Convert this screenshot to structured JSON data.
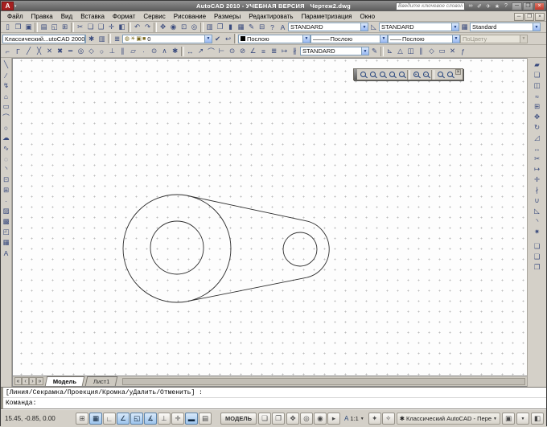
{
  "window": {
    "logo_letter": "A",
    "title_app": "AutoCAD 2010 - УЧЕБНАЯ ВЕРСИЯ",
    "title_doc": "Чертеж2.dwg",
    "infocenter": {
      "placeholder": "Введите ключевое слово/фразу",
      "icons": [
        {
          "name": "search-binoculars-icon",
          "glyph": "∞"
        },
        {
          "name": "tools-icon",
          "glyph": "✐"
        },
        {
          "name": "communication-center-icon",
          "glyph": "✈"
        },
        {
          "name": "favorites-star-icon",
          "glyph": "★"
        },
        {
          "name": "help-icon",
          "glyph": "?"
        }
      ]
    },
    "controls": {
      "minimize": "─",
      "restore": "❐",
      "close": "×"
    },
    "doc_controls": {
      "minimize": "─",
      "restore": "❐",
      "close": "×"
    }
  },
  "menu": {
    "items": [
      {
        "name": "menu-file",
        "label": "Файл"
      },
      {
        "name": "menu-edit",
        "label": "Правка"
      },
      {
        "name": "menu-view",
        "label": "Вид"
      },
      {
        "name": "menu-insert",
        "label": "Вставка"
      },
      {
        "name": "menu-format",
        "label": "Формат"
      },
      {
        "name": "menu-tools",
        "label": "Сервис"
      },
      {
        "name": "menu-draw",
        "label": "Рисование"
      },
      {
        "name": "menu-dimension",
        "label": "Размеры"
      },
      {
        "name": "menu-modify",
        "label": "Редактировать"
      },
      {
        "name": "menu-parametric",
        "label": "Параметризация"
      },
      {
        "name": "menu-window",
        "label": "Окно"
      }
    ]
  },
  "toolbars": {
    "standard": {
      "icons": [
        {
          "name": "qnew-icon",
          "glyph": "▯"
        },
        {
          "name": "open-icon",
          "glyph": "❒"
        },
        {
          "name": "save-icon",
          "glyph": "▣"
        },
        {
          "divider": true
        },
        {
          "name": "plot-icon",
          "glyph": "▤"
        },
        {
          "name": "plot-preview-icon",
          "glyph": "◱"
        },
        {
          "name": "publish-icon",
          "glyph": "⊞"
        },
        {
          "divider": true
        },
        {
          "name": "cut-icon",
          "glyph": "✂"
        },
        {
          "name": "copy-clip-icon",
          "glyph": "❏"
        },
        {
          "name": "paste-icon",
          "glyph": "❑"
        },
        {
          "name": "match-properties-icon",
          "glyph": "✛"
        },
        {
          "name": "block-editor-icon",
          "glyph": "◧"
        },
        {
          "divider": true
        },
        {
          "name": "undo-icon",
          "glyph": "↶"
        },
        {
          "name": "redo-icon",
          "glyph": "↷"
        },
        {
          "divider": true
        },
        {
          "name": "pan-realtime-icon",
          "glyph": "✥"
        },
        {
          "name": "zoom-realtime-icon",
          "glyph": "◉"
        },
        {
          "name": "zoom-window-icon",
          "glyph": "⊡"
        },
        {
          "name": "zoom-previous-icon",
          "glyph": "◎"
        },
        {
          "divider": true
        },
        {
          "name": "properties-palette-icon",
          "glyph": "▥"
        },
        {
          "name": "designcenter-icon",
          "glyph": "❐"
        },
        {
          "name": "tool-palettes-icon",
          "glyph": "▮"
        },
        {
          "name": "sheet-set-manager-icon",
          "glyph": "▦"
        },
        {
          "name": "markup-icon",
          "glyph": "✎"
        },
        {
          "name": "quickcalc-icon",
          "glyph": "⊟"
        },
        {
          "name": "help-question-icon",
          "glyph": "?"
        }
      ]
    },
    "styles": {
      "text_style_icon": "A",
      "text_style": "STANDARD",
      "dim_style_icon": "◺",
      "dim_style": "STANDARD",
      "table_style_icon": "▦",
      "table_style": "Standard"
    },
    "workspace": {
      "value": "Классический...utoCAD 2000",
      "icons": [
        {
          "name": "workspace-settings-icon",
          "glyph": "✱"
        },
        {
          "name": "workspace-save-icon",
          "glyph": "▥"
        }
      ]
    },
    "layers": {
      "manager_glyph": "≣",
      "combo_icons": [
        {
          "name": "layer-on-bulb-icon",
          "glyph": "◍"
        },
        {
          "name": "layer-freeze-sun-icon",
          "glyph": "☀"
        },
        {
          "name": "layer-lock-icon",
          "glyph": "▣"
        },
        {
          "name": "layer-color-swatch-icon",
          "glyph": "■"
        }
      ],
      "current": "0",
      "after_icons": [
        {
          "name": "make-object-layer-current-icon",
          "glyph": "✔"
        },
        {
          "name": "layer-previous-icon",
          "glyph": "↩"
        }
      ]
    },
    "properties": {
      "color": "Послою",
      "linetype_prefix": "———",
      "linetype": "Послою",
      "lineweight_prefix": "——",
      "lineweight": "Послою",
      "plotstyle": "ПоЦвету"
    },
    "osnap": {
      "icons": [
        {
          "name": "temporary-track-point-icon",
          "glyph": "⌐"
        },
        {
          "name": "snap-from-icon",
          "glyph": "Γ"
        },
        {
          "name": "snap-endpoint-icon",
          "glyph": "╱"
        },
        {
          "name": "snap-midpoint-icon",
          "glyph": "╳"
        },
        {
          "name": "snap-intersection-icon",
          "glyph": "✕"
        },
        {
          "name": "snap-apparent-intersection-icon",
          "glyph": "✖"
        },
        {
          "name": "snap-extension-icon",
          "glyph": "━"
        },
        {
          "name": "snap-center-icon",
          "glyph": "◎"
        },
        {
          "name": "snap-quadrant-icon",
          "glyph": "◇"
        },
        {
          "name": "snap-tangent-icon",
          "glyph": "○"
        },
        {
          "name": "snap-perpendicular-icon",
          "glyph": "⊥"
        },
        {
          "name": "snap-parallel-icon",
          "glyph": "∥"
        },
        {
          "name": "snap-insert-icon",
          "glyph": "▱"
        },
        {
          "name": "snap-node-icon",
          "glyph": "∙"
        },
        {
          "name": "snap-nearest-icon",
          "glyph": "⊙"
        },
        {
          "name": "snap-none-icon",
          "glyph": "∧"
        },
        {
          "name": "osnap-settings-icon",
          "glyph": "✱"
        }
      ]
    },
    "dimension": {
      "icons": [
        {
          "name": "dim-linear-icon",
          "glyph": "↔"
        },
        {
          "name": "dim-aligned-icon",
          "glyph": "↗"
        },
        {
          "name": "dim-arc-length-icon",
          "glyph": "⌒"
        },
        {
          "name": "dim-ordinate-icon",
          "glyph": "⊢"
        },
        {
          "name": "dim-radius-icon",
          "glyph": "⊙"
        },
        {
          "name": "dim-diameter-icon",
          "glyph": "⊘"
        },
        {
          "name": "dim-angular-icon",
          "glyph": "∠"
        },
        {
          "name": "dim-quick-icon",
          "glyph": "≡"
        },
        {
          "name": "dim-baseline-icon",
          "glyph": "≣"
        },
        {
          "name": "dim-continue-icon",
          "glyph": "↦"
        },
        {
          "name": "dim-break-icon",
          "glyph": "∦"
        }
      ],
      "style": "STANDARD",
      "after_icons": [
        {
          "name": "dimension-update-icon",
          "glyph": "✎"
        }
      ]
    },
    "parametric": {
      "icons": [
        {
          "name": "auto-constrain-icon",
          "glyph": "⊾"
        },
        {
          "name": "geometric-constraint-icon",
          "glyph": "△"
        },
        {
          "name": "show-constraints-icon",
          "glyph": "◫"
        },
        {
          "name": "infer-constraints-icon",
          "glyph": "∥"
        },
        {
          "name": "dimensional-constraint-icon",
          "glyph": "◇"
        },
        {
          "name": "show-dynamic-constraints-icon",
          "glyph": "▭"
        },
        {
          "name": "delete-constraints-icon",
          "glyph": "✕"
        },
        {
          "name": "parameters-manager-icon",
          "glyph": "ƒ"
        }
      ]
    },
    "draw": {
      "icons": [
        {
          "name": "line-icon",
          "glyph": "╲"
        },
        {
          "name": "construction-line-icon",
          "glyph": "∕"
        },
        {
          "name": "polyline-icon",
          "glyph": "↯"
        },
        {
          "name": "polygon-icon",
          "glyph": "⌂"
        },
        {
          "name": "rectangle-icon",
          "glyph": "▭"
        },
        {
          "name": "arc-icon",
          "glyph": "⌒"
        },
        {
          "name": "circle-icon",
          "glyph": "○"
        },
        {
          "name": "revision-cloud-icon",
          "glyph": "☁"
        },
        {
          "name": "spline-icon",
          "glyph": "∿"
        },
        {
          "name": "ellipse-icon",
          "glyph": "◌"
        },
        {
          "name": "ellipse-arc-icon",
          "glyph": "◝"
        },
        {
          "name": "insert-block-icon",
          "glyph": "⊡"
        },
        {
          "name": "make-block-icon",
          "glyph": "⊞"
        },
        {
          "name": "point-icon",
          "glyph": "∙"
        },
        {
          "name": "hatch-icon",
          "glyph": "▨"
        },
        {
          "name": "gradient-icon",
          "glyph": "▩"
        },
        {
          "name": "region-icon",
          "glyph": "◰"
        },
        {
          "name": "table-icon",
          "glyph": "▦"
        },
        {
          "name": "multiline-text-icon",
          "glyph": "A"
        }
      ]
    },
    "modify": {
      "icons": [
        {
          "name": "erase-icon",
          "glyph": "▰"
        },
        {
          "name": "copy-icon",
          "glyph": "❏"
        },
        {
          "name": "mirror-icon",
          "glyph": "◫"
        },
        {
          "name": "offset-icon",
          "glyph": "≈"
        },
        {
          "name": "array-icon",
          "glyph": "⊞"
        },
        {
          "name": "move-icon",
          "glyph": "✥"
        },
        {
          "name": "rotate-icon",
          "glyph": "↻"
        },
        {
          "name": "scale-icon",
          "glyph": "◿"
        },
        {
          "name": "stretch-icon",
          "glyph": "↔"
        },
        {
          "name": "trim-icon",
          "glyph": "✂"
        },
        {
          "name": "extend-icon",
          "glyph": "↦"
        },
        {
          "name": "break-at-point-icon",
          "glyph": "✛"
        },
        {
          "name": "break-icon",
          "glyph": "∤"
        },
        {
          "name": "join-icon",
          "glyph": "∪"
        },
        {
          "name": "chamfer-icon",
          "glyph": "◺"
        },
        {
          "name": "fillet-icon",
          "glyph": "◝"
        },
        {
          "name": "explode-icon",
          "glyph": "✷"
        }
      ]
    },
    "order": {
      "icons": [
        {
          "name": "bring-to-front-icon",
          "glyph": "❏"
        },
        {
          "name": "send-to-back-icon",
          "glyph": "❑"
        },
        {
          "name": "bring-above-objects-icon",
          "glyph": "❐"
        }
      ]
    },
    "zoom_float": {
      "icons": [
        {
          "name": "zoom-window-button",
          "char": ""
        },
        {
          "name": "zoom-dynamic-button",
          "char": ""
        },
        {
          "name": "zoom-scale-button",
          "char": ""
        },
        {
          "name": "zoom-center-button",
          "char": ""
        },
        {
          "name": "zoom-object-button",
          "char": ""
        },
        {
          "divider": true
        },
        {
          "name": "zoom-in-button",
          "char": "+"
        },
        {
          "name": "zoom-out-button",
          "char": "−"
        },
        {
          "divider": true
        },
        {
          "name": "zoom-all-button",
          "char": ""
        },
        {
          "name": "zoom-extents-button",
          "char": ""
        }
      ],
      "close_glyph": "×"
    }
  },
  "tabs": {
    "nav": [
      {
        "name": "first-layout-button",
        "glyph": "«"
      },
      {
        "name": "prev-layout-button",
        "glyph": "‹"
      },
      {
        "name": "next-layout-button",
        "glyph": "›"
      },
      {
        "name": "last-layout-button",
        "glyph": "»"
      }
    ],
    "model": "Модель",
    "layout1": "Лист1"
  },
  "command": {
    "history": "[Линия/Секрамка/Проекция/Кромка/уДалить/Отменить] :",
    "prompt": "Команда:"
  },
  "statusbar": {
    "coords": "15.45, -0.85, 0.00",
    "toggles": [
      {
        "name": "snap-toggle",
        "glyph": "⊞",
        "active": false
      },
      {
        "name": "grid-toggle",
        "glyph": "▦",
        "active": true
      },
      {
        "name": "ortho-toggle",
        "glyph": "∟",
        "active": false
      },
      {
        "name": "polar-toggle",
        "glyph": "∠",
        "active": true
      },
      {
        "name": "osnap-toggle",
        "glyph": "◱",
        "active": true
      },
      {
        "name": "otrack-toggle",
        "glyph": "∡",
        "active": true
      },
      {
        "name": "ducs-toggle",
        "glyph": "⊥",
        "active": false
      },
      {
        "name": "dyn-toggle",
        "glyph": "✛",
        "active": false
      },
      {
        "name": "lwt-toggle",
        "glyph": "▬",
        "active": true
      },
      {
        "name": "qp-toggle",
        "glyph": "▤",
        "active": false
      }
    ],
    "model_label": "МОДЕЛЬ",
    "layout_icons": [
      {
        "name": "quick-view-layouts-icon",
        "glyph": "❏"
      },
      {
        "name": "quick-view-drawings-icon",
        "glyph": "❐"
      }
    ],
    "nav_icons": [
      {
        "name": "pan-icon",
        "glyph": "✥"
      },
      {
        "name": "zoom-icon",
        "glyph": "◎"
      },
      {
        "name": "steering-wheel-icon",
        "glyph": "◉"
      },
      {
        "name": "show-motion-icon",
        "glyph": "▸"
      }
    ],
    "annotation": {
      "scale_icon": "A",
      "scale": "1:1",
      "icons": [
        {
          "name": "annotation-visibility-icon",
          "glyph": "✦"
        },
        {
          "name": "annotation-auto-scale-icon",
          "glyph": "✧"
        }
      ]
    },
    "workspace": {
      "gear": "✱",
      "label": "Классический AutoCAD - Пере"
    },
    "lock_glyph": "▣",
    "clean_screen_glyph": "◧"
  }
}
